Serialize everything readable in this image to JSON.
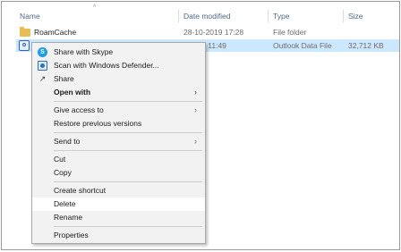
{
  "columns": {
    "name": "Name",
    "date_modified": "Date modified",
    "type": "Type",
    "size": "Size"
  },
  "files": [
    {
      "name": "RoamCache",
      "date": "28-10-2019 17:28",
      "type": "File folder",
      "size": "",
      "icon": "folder-icon"
    },
    {
      "name": "",
      "date": "2020 11:49",
      "type": "Outlook Data File",
      "size": "32,712 KB",
      "icon": "pst-icon",
      "selected": true
    }
  ],
  "context_menu": {
    "items": [
      {
        "label": "Share with Skype",
        "icon": "skype-icon"
      },
      {
        "label": "Scan with Windows Defender...",
        "icon": "windows-defender-icon"
      },
      {
        "label": "Share",
        "icon": "share-icon"
      },
      {
        "label": "Open with",
        "bold": true,
        "submenu": true
      },
      {
        "label": "Give access to",
        "submenu": true
      },
      {
        "label": "Restore previous versions"
      },
      {
        "label": "Send to",
        "submenu": true
      },
      {
        "label": "Cut"
      },
      {
        "label": "Copy"
      },
      {
        "label": "Create shortcut"
      },
      {
        "label": "Delete",
        "highlighted": true
      },
      {
        "label": "Rename"
      },
      {
        "label": "Properties"
      }
    ]
  },
  "colors": {
    "selection": "#cce8ff",
    "header_text": "#4d6b8a",
    "menu_bg": "#f2f2f2"
  }
}
